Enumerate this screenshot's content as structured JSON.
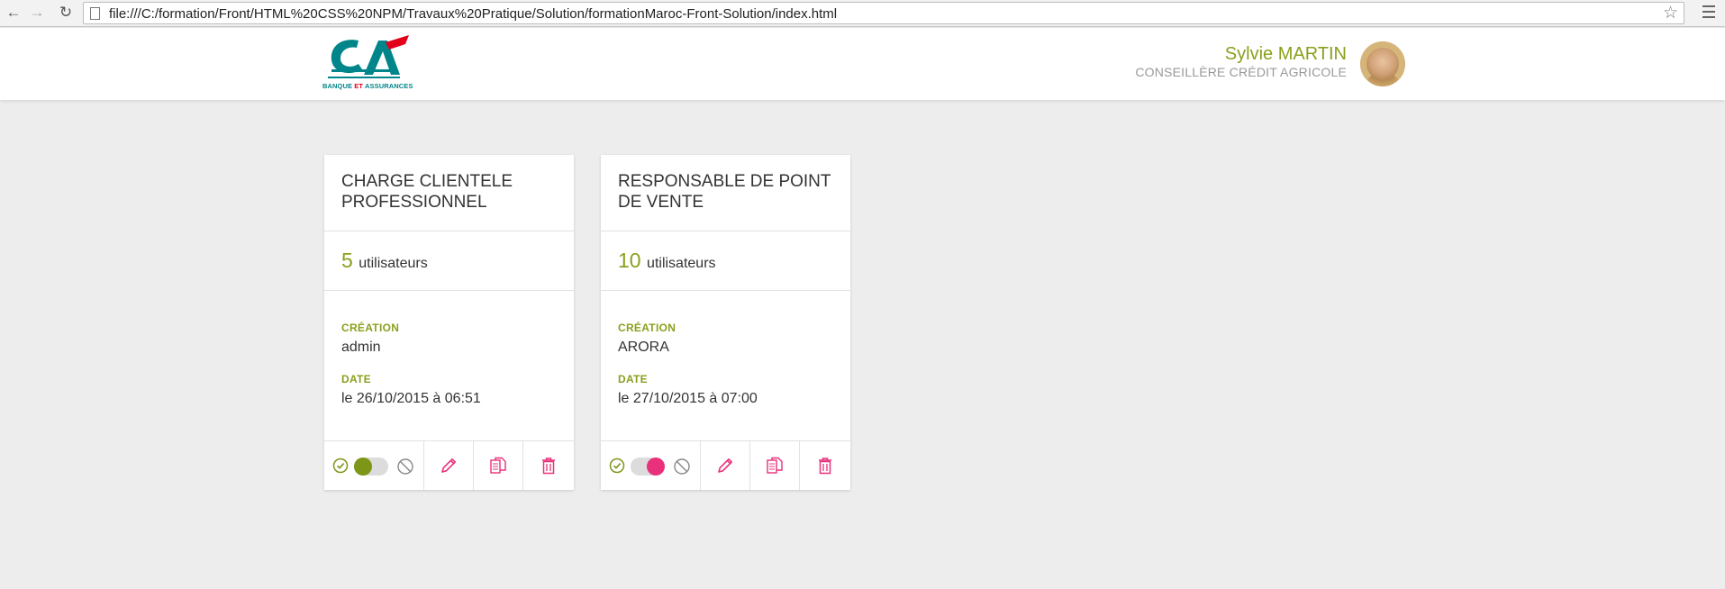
{
  "browser": {
    "url": "file:///C:/formation/Front/HTML%20CSS%20NPM/Travaux%20Pratique/Solution/formationMaroc-Front-Solution/index.html"
  },
  "header": {
    "logo_text_1": "BANQUE ",
    "logo_text_et": "ET",
    "logo_text_2": " ASSURANCES",
    "logo_initials": "CA",
    "user_name": "Sylvie MARTIN",
    "user_role": "CONSEILLÈRE CRÉDIT AGRICOLE"
  },
  "cards": [
    {
      "title": "CHARGE CLIENTELE PROFESSIONNEL",
      "user_count": "5",
      "user_label": "utilisateurs",
      "creation_label": "CRÉATION",
      "creation_value": "admin",
      "date_label": "DATE",
      "date_value": "le 26/10/2015 à 06:51",
      "active": true
    },
    {
      "title": "RESPONSABLE DE POINT DE VENTE",
      "user_count": "10",
      "user_label": "utilisateurs",
      "creation_label": "CRÉATION",
      "creation_value": "ARORA",
      "date_label": "DATE",
      "date_value": "le 27/10/2015 à 07:00",
      "active": false
    }
  ],
  "colors": {
    "accent_green": "#8aa01e",
    "accent_pink": "#e8317a",
    "background": "#ededed"
  },
  "icons": [
    "back-arrow-icon",
    "forward-arrow-icon",
    "reload-icon",
    "page-icon",
    "star-icon",
    "menu-icon",
    "check-circle-icon",
    "ban-icon",
    "pencil-icon",
    "copy-icon",
    "trash-icon"
  ]
}
